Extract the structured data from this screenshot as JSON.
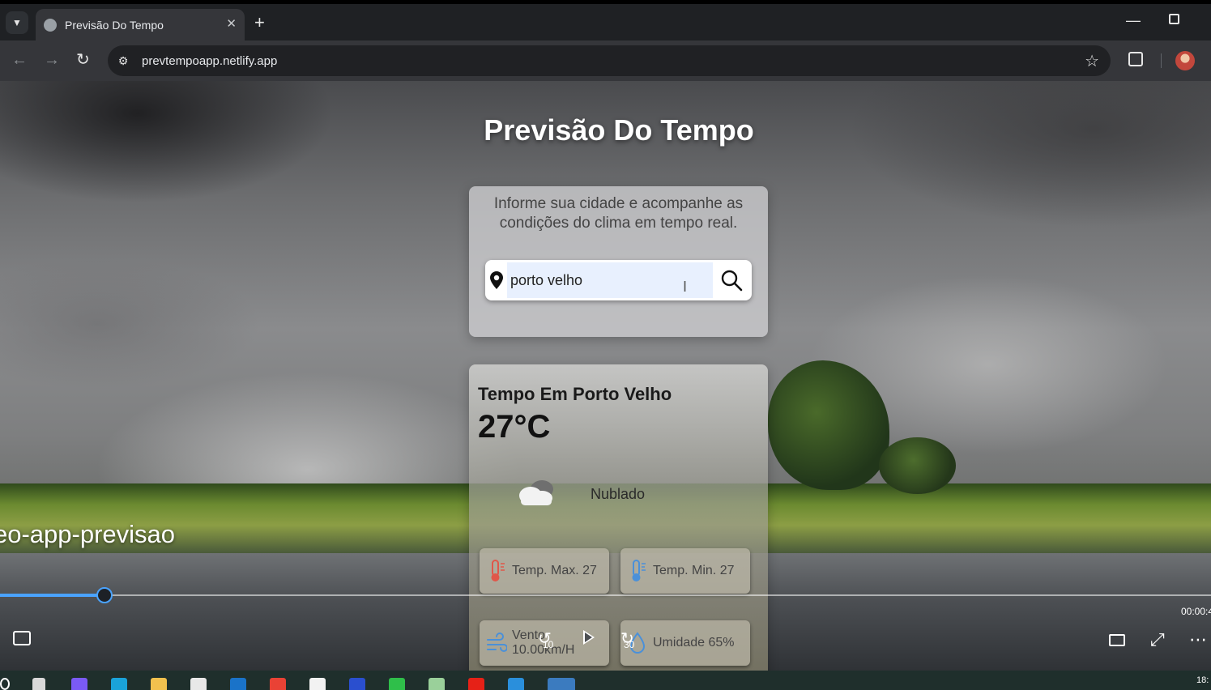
{
  "browser": {
    "tab_title": "Previsão Do Tempo",
    "new_tab_label": "+",
    "url": "prevtempoapp.netlify.app"
  },
  "app": {
    "title": "Previsão Do Tempo",
    "description": "Informe sua cidade e acompanhe as condições do clima em tempo real.",
    "search": {
      "value": "porto velho",
      "placeholder": ""
    },
    "weather": {
      "city_heading": "Tempo Em Porto Velho",
      "temperature": "27°C",
      "condition": "Nublado",
      "temp_max": "Temp. Max. 27",
      "temp_min": "Temp. Min. 27",
      "wind": "Vento 10.00km/H",
      "humidity": "Umidade 65%"
    }
  },
  "video_player": {
    "video_title": "eo-app-previsao",
    "progress": 0.086,
    "time": "00:00:4",
    "rewind_seconds": "10",
    "forward_seconds": "30"
  },
  "taskbar": {
    "clock": "18:"
  },
  "colors": {
    "accent": "#4aa3ff",
    "thermo_hot": "#e0574a",
    "thermo_cold": "#4a90d9"
  }
}
